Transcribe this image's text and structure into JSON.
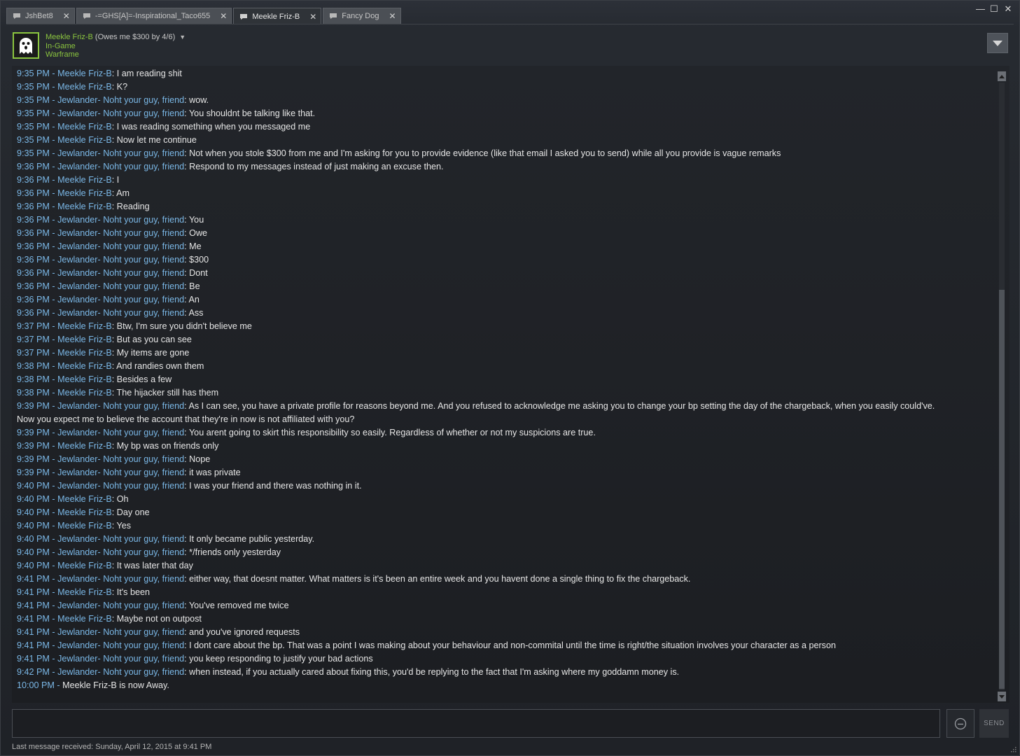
{
  "tabs": [
    {
      "label": "JshBet8",
      "close": "✕"
    },
    {
      "label": "-=GHS[A]=-Inspirational_Taco655",
      "close": "✕"
    },
    {
      "label": "Meekle Friz-B",
      "close": "✕"
    },
    {
      "label": "Fancy Dog",
      "close": "✕"
    }
  ],
  "window_controls": {
    "minimize": "—",
    "maximize": "☐",
    "close": "✕"
  },
  "header": {
    "name": "Meekle Friz-B",
    "nickname": " (Owes me $300 by 4/6)",
    "status": "In-Game",
    "game": "Warframe"
  },
  "messages": [
    {
      "ts": "9:35 PM - ",
      "sender": "Meekle Friz-B",
      "text": ": I am reading shit"
    },
    {
      "ts": "9:35 PM - ",
      "sender": "Meekle Friz-B",
      "text": ": K?"
    },
    {
      "ts": "9:35 PM - ",
      "sender": "Jewlander- Noht your guy, friend",
      "text": ": wow."
    },
    {
      "ts": "9:35 PM - ",
      "sender": "Jewlander- Noht your guy, friend",
      "text": ": You shouldnt be talking like that."
    },
    {
      "ts": "9:35 PM - ",
      "sender": "Meekle Friz-B",
      "text": ": I was reading something when you messaged me"
    },
    {
      "ts": "9:35 PM - ",
      "sender": "Meekle Friz-B",
      "text": ": Now let me continue"
    },
    {
      "ts": "9:35 PM - ",
      "sender": "Jewlander- Noht your guy, friend",
      "text": ": Not when you stole $300 from me and I'm asking for you to provide evidence (like that email I asked you to send) while all you provide is vague remarks"
    },
    {
      "ts": "9:36 PM - ",
      "sender": "Jewlander- Noht your guy, friend",
      "text": ": Respond to my messages instead of just making an excuse then."
    },
    {
      "ts": "9:36 PM - ",
      "sender": "Meekle Friz-B",
      "text": ": I"
    },
    {
      "ts": "9:36 PM - ",
      "sender": "Meekle Friz-B",
      "text": ": Am"
    },
    {
      "ts": "9:36 PM - ",
      "sender": "Meekle Friz-B",
      "text": ": Reading"
    },
    {
      "ts": "9:36 PM - ",
      "sender": "Jewlander- Noht your guy, friend",
      "text": ": You"
    },
    {
      "ts": "9:36 PM - ",
      "sender": "Jewlander- Noht your guy, friend",
      "text": ": Owe"
    },
    {
      "ts": "9:36 PM - ",
      "sender": "Jewlander- Noht your guy, friend",
      "text": ": Me"
    },
    {
      "ts": "9:36 PM - ",
      "sender": "Jewlander- Noht your guy, friend",
      "text": ": $300"
    },
    {
      "ts": "9:36 PM - ",
      "sender": "Jewlander- Noht your guy, friend",
      "text": ": Dont"
    },
    {
      "ts": "9:36 PM - ",
      "sender": "Jewlander- Noht your guy, friend",
      "text": ": Be"
    },
    {
      "ts": "9:36 PM - ",
      "sender": "Jewlander- Noht your guy, friend",
      "text": ": An"
    },
    {
      "ts": "9:36 PM - ",
      "sender": "Jewlander- Noht your guy, friend",
      "text": ": Ass"
    },
    {
      "ts": "9:37 PM - ",
      "sender": "Meekle Friz-B",
      "text": ": Btw, I'm sure you didn't believe me"
    },
    {
      "ts": "9:37 PM - ",
      "sender": "Meekle Friz-B",
      "text": ": But as you can see"
    },
    {
      "ts": "9:37 PM - ",
      "sender": "Meekle Friz-B",
      "text": ": My items are gone"
    },
    {
      "ts": "9:38 PM - ",
      "sender": "Meekle Friz-B",
      "text": ": And randies own them"
    },
    {
      "ts": "9:38 PM - ",
      "sender": "Meekle Friz-B",
      "text": ": Besides a few"
    },
    {
      "ts": "9:38 PM - ",
      "sender": "Meekle Friz-B",
      "text": ": The hijacker still has them"
    },
    {
      "ts": "9:39 PM - ",
      "sender": "Jewlander- Noht your guy, friend",
      "text": ": As I can see, you have a private profile for reasons beyond me. And you refused to acknowledge me asking you to change your bp setting the day of the chargeback, when you easily could've.\nNow you expect me to believe the account that they're in now is not affiliated with you?"
    },
    {
      "ts": "9:39 PM - ",
      "sender": "Jewlander- Noht your guy, friend",
      "text": ": You arent going to skirt this responsibility so easily. Regardless of whether or not my suspicions are true."
    },
    {
      "ts": "9:39 PM - ",
      "sender": "Meekle Friz-B",
      "text": ": My bp was on friends only"
    },
    {
      "ts": "9:39 PM - ",
      "sender": "Jewlander- Noht your guy, friend",
      "text": ": Nope"
    },
    {
      "ts": "9:39 PM - ",
      "sender": "Jewlander- Noht your guy, friend",
      "text": ": it was private"
    },
    {
      "ts": "9:40 PM - ",
      "sender": "Jewlander- Noht your guy, friend",
      "text": ": I was your friend and there was nothing in it."
    },
    {
      "ts": "9:40 PM - ",
      "sender": "Meekle Friz-B",
      "text": ": Oh"
    },
    {
      "ts": "9:40 PM - ",
      "sender": "Meekle Friz-B",
      "text": ": Day one"
    },
    {
      "ts": "9:40 PM - ",
      "sender": "Meekle Friz-B",
      "text": ": Yes"
    },
    {
      "ts": "9:40 PM - ",
      "sender": "Jewlander- Noht your guy, friend",
      "text": ": It only became public yesterday."
    },
    {
      "ts": "9:40 PM - ",
      "sender": "Jewlander- Noht your guy, friend",
      "text": ": */friends only yesterday"
    },
    {
      "ts": "9:40 PM - ",
      "sender": "Meekle Friz-B",
      "text": ": It was later that day"
    },
    {
      "ts": "9:41 PM - ",
      "sender": "Jewlander- Noht your guy, friend",
      "text": ": either way, that doesnt matter. What matters is it's been an entire week and you havent done a single thing to fix the chargeback."
    },
    {
      "ts": "9:41 PM - ",
      "sender": "Meekle Friz-B",
      "text": ": It's been"
    },
    {
      "ts": "9:41 PM - ",
      "sender": "Jewlander- Noht your guy, friend",
      "text": ": You've removed me twice"
    },
    {
      "ts": "9:41 PM - ",
      "sender": "Meekle Friz-B",
      "text": ": Maybe not on outpost"
    },
    {
      "ts": "9:41 PM - ",
      "sender": "Jewlander- Noht your guy, friend",
      "text": ": and you've ignored requests"
    },
    {
      "ts": "9:41 PM - ",
      "sender": "Jewlander- Noht your guy, friend",
      "text": ": I dont care about the bp. That was a point I was making about your behaviour and non-commital until the time is right/the situation involves your character as a person"
    },
    {
      "ts": "9:41 PM - ",
      "sender": "Jewlander- Noht your guy, friend",
      "text": ": you keep responding to justify your bad actions"
    },
    {
      "ts": "9:42 PM - ",
      "sender": "Jewlander- Noht your guy, friend",
      "text": ": when instead, if you actually cared about fixing this, you'd be replying to the fact that I'm asking where my goddamn money is."
    },
    {
      "ts": "10:00 PM - ",
      "sender": "",
      "text": "Meekle Friz-B is now Away."
    }
  ],
  "input": {
    "value": ""
  },
  "send_label": "SEND",
  "footer": "Last message received: Sunday, April 12, 2015 at 9:41 PM",
  "colors": {
    "accent_green": "#8bc53f",
    "timestamp_blue": "#7ab7e6",
    "text": "#e6e6e6"
  }
}
